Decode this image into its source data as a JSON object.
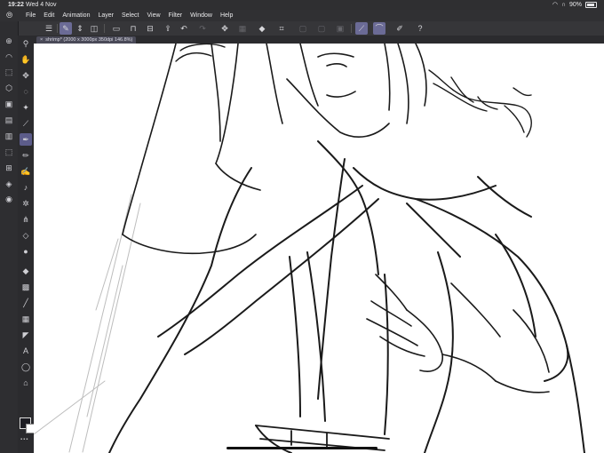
{
  "status_bar": {
    "time": "19:22",
    "date": "Wed 4 Nov",
    "battery_percent": "90%"
  },
  "menu": {
    "items": [
      "File",
      "Edit",
      "Animation",
      "Layer",
      "Select",
      "View",
      "Filter",
      "Window",
      "Help"
    ]
  },
  "document_tab": {
    "close_glyph": "×",
    "title": "shrimp* (2000 x 3000px 350dpi 146.8%)"
  },
  "colors": {
    "main_color": "#1c1c22",
    "sub_color": "#ffffff",
    "accent": "#6b6b96"
  }
}
